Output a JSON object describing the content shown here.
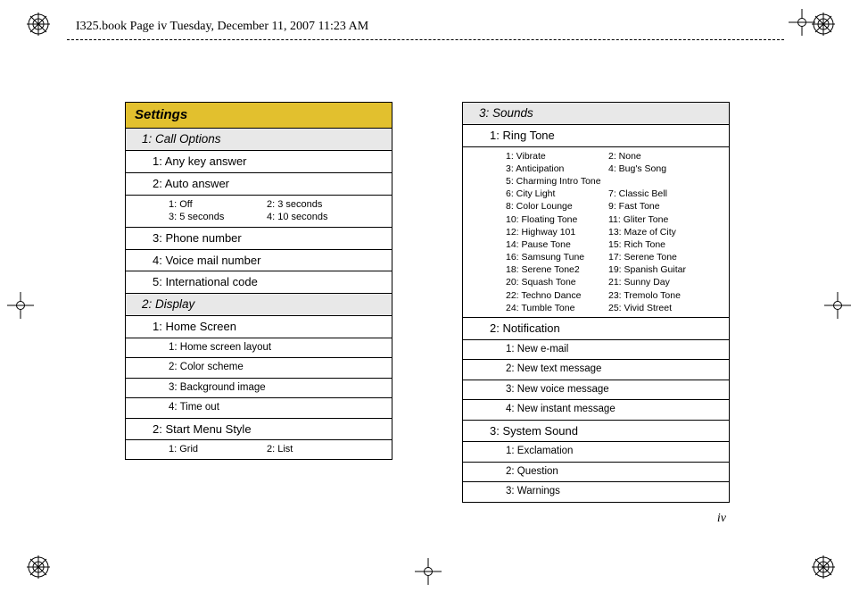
{
  "header_text": "I325.book  Page iv  Tuesday, December 11, 2007  11:23 AM",
  "page_number": "iv",
  "left": {
    "title": "Settings",
    "s1": {
      "title": "1: Call Options",
      "i1": "1: Any key answer",
      "i2": "2: Auto answer",
      "i2_opts": {
        "a": "1: Off",
        "b": "2: 3 seconds",
        "c": "3: 5 seconds",
        "d": "4: 10 seconds"
      },
      "i3": "3: Phone number",
      "i4": "4: Voice mail number",
      "i5": "5: International code"
    },
    "s2": {
      "title": "2: Display",
      "i1": "1: Home Screen",
      "i1_1": "1: Home screen layout",
      "i1_2": "2: Color scheme",
      "i1_3": "3: Background image",
      "i1_4": "4: Time out",
      "i2": "2: Start Menu Style",
      "i2_opts": {
        "a": "1: Grid",
        "b": "2: List"
      }
    }
  },
  "right": {
    "s3": {
      "title": "3: Sounds",
      "rt": {
        "title": "1: Ring Tone",
        "p1a": "1: Vibrate",
        "p1b": "2: None",
        "p2a": "3: Anticipation",
        "p2b": "4: Bug's Song",
        "p3": "5: Charming Intro Tone",
        "p4a": "6: City Light",
        "p4b": "7: Classic Bell",
        "p5a": "8: Color Lounge",
        "p5b": "9: Fast Tone",
        "p6a": "10: Floating Tone",
        "p6b": "11: Gliter Tone",
        "p7a": "12: Highway 101",
        "p7b": "13: Maze of City",
        "p8a": "14: Pause Tone",
        "p8b": "15: Rich Tone",
        "p9a": "16: Samsung Tune",
        "p9b": "17: Serene Tone",
        "p10a": "18: Serene Tone2",
        "p10b": "19: Spanish Guitar",
        "p11a": "20: Squash Tone",
        "p11b": "21: Sunny Day",
        "p12a": "22: Techno Dance",
        "p12b": "23: Tremolo Tone",
        "p13a": "24: Tumble Tone",
        "p13b": "25: Vivid Street"
      },
      "notif": {
        "title": "2: Notification",
        "i1": "1: New e-mail",
        "i2": "2: New text message",
        "i3": "3: New voice message",
        "i4": "4: New instant message"
      },
      "sys": {
        "title": "3: System Sound",
        "i1": "1: Exclamation",
        "i2": "2: Question",
        "i3": "3: Warnings"
      }
    }
  }
}
